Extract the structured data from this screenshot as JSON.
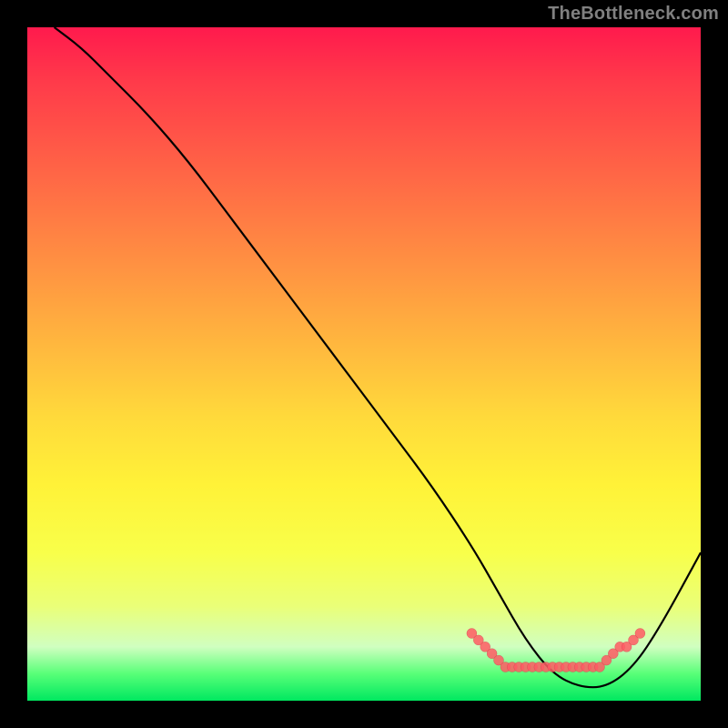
{
  "attribution": "TheBottleneck.com",
  "colors": {
    "frame_bg": "#000000",
    "curve": "#000000",
    "markers": "#ff5a64",
    "attribution_text": "#808080"
  },
  "chart_data": {
    "type": "line",
    "title": "",
    "xlabel": "",
    "ylabel": "",
    "xlim": [
      0,
      100
    ],
    "ylim": [
      0,
      100
    ],
    "background_gradient": "red-to-green vertical",
    "curve": {
      "x": [
        4,
        8,
        12,
        18,
        24,
        30,
        36,
        42,
        48,
        54,
        60,
        66,
        70,
        74,
        78,
        82,
        86,
        90,
        94,
        100
      ],
      "y": [
        100,
        97,
        93,
        87,
        80,
        72,
        64,
        56,
        48,
        40,
        32,
        23,
        16,
        9,
        4,
        2,
        2,
        5,
        11,
        22
      ]
    },
    "markers": {
      "note": "dense salmon dots along the valley floor of the curve",
      "points": [
        {
          "x": 66,
          "y": 10
        },
        {
          "x": 67,
          "y": 9
        },
        {
          "x": 68,
          "y": 8
        },
        {
          "x": 69,
          "y": 7
        },
        {
          "x": 70,
          "y": 6
        },
        {
          "x": 71,
          "y": 5
        },
        {
          "x": 72,
          "y": 5
        },
        {
          "x": 73,
          "y": 5
        },
        {
          "x": 74,
          "y": 5
        },
        {
          "x": 75,
          "y": 5
        },
        {
          "x": 76,
          "y": 5
        },
        {
          "x": 77,
          "y": 5
        },
        {
          "x": 78,
          "y": 5
        },
        {
          "x": 79,
          "y": 5
        },
        {
          "x": 80,
          "y": 5
        },
        {
          "x": 81,
          "y": 5
        },
        {
          "x": 82,
          "y": 5
        },
        {
          "x": 83,
          "y": 5
        },
        {
          "x": 84,
          "y": 5
        },
        {
          "x": 85,
          "y": 5
        },
        {
          "x": 86,
          "y": 6
        },
        {
          "x": 87,
          "y": 7
        },
        {
          "x": 88,
          "y": 8
        },
        {
          "x": 89,
          "y": 8
        },
        {
          "x": 90,
          "y": 9
        },
        {
          "x": 91,
          "y": 10
        }
      ]
    }
  }
}
